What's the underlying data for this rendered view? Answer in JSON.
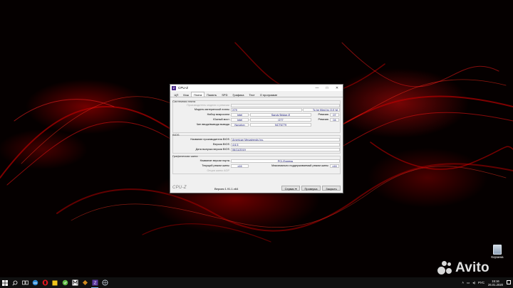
{
  "window": {
    "title": "CPU-Z",
    "controls": {
      "minimize": "—",
      "maximize": "□",
      "close": "✕"
    },
    "tabs": [
      "ЦП",
      "Кэш",
      "Плата",
      "Память",
      "SPD",
      "Графика",
      "Тест",
      "О программе"
    ],
    "active_tab": "Плата"
  },
  "motherboard": {
    "section_title": "Системная плата",
    "manufacturer_label": "Производитель модели и ревизии",
    "manufacturer_value": "",
    "model_label": "Модель материнской платы",
    "model_value": "X79",
    "model_extra": "To be filled by O.E.M.",
    "chipset_label": "Набор микросхем",
    "chipset_vendor": "Intel",
    "chipset_name": "Sandy Bridge-E",
    "chipset_rev_label": "Ревизия",
    "chipset_rev": "07",
    "southbridge_label": "Южный мост",
    "southbridge_vendor": "Intel",
    "southbridge_name": "Q77",
    "southbridge_rev_label": "Ревизия",
    "southbridge_rev": "04",
    "lpcio_label": "Чип ввода/вывода вывода",
    "lpcio_vendor": "Nuvoton",
    "lpcio_name": "NCT6779"
  },
  "bios": {
    "section_title": "BIOS",
    "brand_label": "Название производителя BIOS",
    "brand_value": "American Megatrends Inc.",
    "version_label": "Версия BIOS",
    "version_value": "4.6.5",
    "date_label": "Дата выпуска версии BIOS",
    "date_value": "06/11/2019"
  },
  "graphic": {
    "section_title": "Графическая шина",
    "bus_label": "Название версии порта",
    "bus_value": "PCI-Express",
    "link_label": "Текущий режим шины",
    "link_value": "x16",
    "max_label": "Максимально поддерживаемый режим шины",
    "max_value": "x16",
    "side_label": "Опции шины AGP"
  },
  "footer": {
    "brand": "CPU-Z",
    "version": "Версия 1.91.1.x64",
    "service": "Сервис",
    "service_arrow": "▾",
    "validate": "Проверка",
    "close": "Закрыть"
  },
  "desktop": {
    "recycle_bin": "Корзина",
    "watermark": "Avito"
  },
  "taskbar": {
    "icons": [
      "windows-start",
      "search",
      "task-view",
      "edge",
      "opera",
      "sticky",
      "mail",
      "word-m",
      "winamp",
      "cpu-z",
      "network"
    ],
    "language": "РУС",
    "time": "15:16",
    "date": "26.01.2020"
  }
}
